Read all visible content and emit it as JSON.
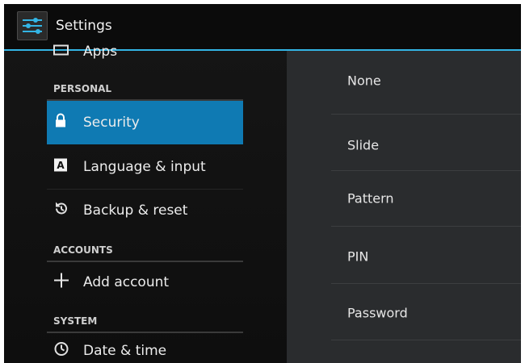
{
  "app": {
    "title": "Settings"
  },
  "left": {
    "partial_item": "Apps",
    "sections": {
      "personal": "PERSONAL",
      "accounts": "ACCOUNTS",
      "system": "SYSTEM"
    },
    "items": {
      "security": "Security",
      "language": "Language & input",
      "backup": "Backup & reset",
      "add_account": "Add account",
      "date_time": "Date & time"
    }
  },
  "right": {
    "options": [
      "None",
      "Slide",
      "Pattern",
      "PIN",
      "Password"
    ]
  },
  "colors": {
    "accent": "#33b5e5",
    "selected": "#0f7ab3"
  }
}
